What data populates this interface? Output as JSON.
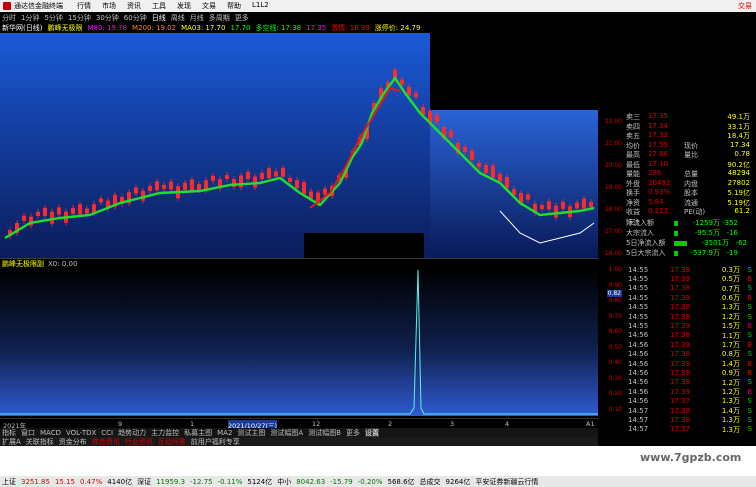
{
  "titlebar": {
    "app_name": "通达信金融终端",
    "menu": [
      "行情",
      "市场",
      "资讯",
      "工具",
      "发现",
      "文易",
      "帮助",
      "L1L2"
    ],
    "right": "交易"
  },
  "toolbar": {
    "items": [
      "分时",
      "1分钟",
      "5分钟",
      "15分钟",
      "30分钟",
      "60分钟",
      "日线",
      "周线",
      "月线",
      "多周期",
      "更多"
    ],
    "active_index": 6
  },
  "stockbar": {
    "name": "新华网(日线)",
    "indicator": "鹏峰无极限",
    "ma5": "M80: 19.78",
    "ma10": "M200: 19.02",
    "ma3": "MA03: 17.70",
    "v1": "17.70",
    "label2": "多空线: 17.38",
    "v2": "17.35",
    "stat1": "激情: 16.99",
    "stat2": "涨停价: 24.79"
  },
  "right_axis_main": [
    "22.00",
    "21.00",
    "20.00",
    "19.00",
    "18.00",
    "17.00",
    "16.00"
  ],
  "info_panel": {
    "rows": [
      {
        "c1": "卖三",
        "c2": "17.35",
        "c3": "",
        "c4": "49.1万"
      },
      {
        "c1": "卖四",
        "c2": "17.34",
        "c3": "",
        "c4": "33.1万"
      },
      {
        "c1": "卖五",
        "c2": "17.33",
        "c3": "",
        "c4": "18.4万"
      },
      {
        "c1": "均价",
        "c2": "17.55",
        "c3": "现价",
        "c4": "17.34"
      },
      {
        "c1": "最高",
        "c2": "17.66",
        "c3": "量比",
        "c4": "0.78"
      },
      {
        "c1": "最低",
        "c2": "17.10",
        "c3": "",
        "c4": "90.2亿"
      },
      {
        "c1": "量能",
        "c2": "286",
        "c3": "总量",
        "c4": "48294"
      },
      {
        "c1": "外盘",
        "c2": "20492",
        "c3": "内盘",
        "c4": "27802"
      },
      {
        "c1": "换手",
        "c2": "0.93%",
        "c3": "股本",
        "c4": "5.19亿"
      },
      {
        "c1": "净资",
        "c2": "5.84",
        "c3": "流通",
        "c4": "5.19亿"
      },
      {
        "c1": "收益(三)",
        "c2": "0.213",
        "c3": "PE(动)",
        "c4": "61.2"
      }
    ],
    "flows": [
      {
        "label": "净流入额",
        "value": "-1259万",
        "pct": "-352",
        "bar": 0.0
      },
      {
        "label": "大宗流入",
        "value": "-95.5万",
        "pct": "-16",
        "bar": 0.0
      },
      {
        "label": "5日净流入额",
        "value": "-3501万",
        "pct": "-62",
        "bar": 0.3
      },
      {
        "label": "5日大宗流入",
        "value": "-537.9万",
        "pct": "-19",
        "bar": 0.0
      }
    ]
  },
  "divider": {
    "name": "鹏峰无极限副",
    "value": "X0: 0.00"
  },
  "axis_sub": [
    "1.00",
    "0.90",
    "0.80",
    "0.70",
    "0.60",
    "0.50",
    "0.40",
    "0.30",
    "0.20",
    "0.10"
  ],
  "sub_marker": "0.82",
  "ticks": [
    {
      "t": "14:55",
      "p": "17.38",
      "v": "0.3万",
      "s": "S"
    },
    {
      "t": "14:55",
      "p": "17.39",
      "v": "0.5万",
      "s": "B"
    },
    {
      "t": "14:55",
      "p": "17.38",
      "v": "0.7万",
      "s": "S"
    },
    {
      "t": "14:55",
      "p": "17.39",
      "v": "0.6万",
      "s": "B"
    },
    {
      "t": "14:55",
      "p": "17.38",
      "v": "1.3万",
      "s": "S"
    },
    {
      "t": "14:55",
      "p": "17.38",
      "v": "1.2万",
      "s": "S"
    },
    {
      "t": "14:55",
      "p": "17.39",
      "v": "1.5万",
      "s": "B"
    },
    {
      "t": "14:56",
      "p": "17.38",
      "v": "1.1万",
      "s": "S"
    },
    {
      "t": "14:56",
      "p": "17.39",
      "v": "1.7万",
      "s": "B"
    },
    {
      "t": "14:56",
      "p": "17.38",
      "v": "0.8万",
      "s": "S"
    },
    {
      "t": "14:56",
      "p": "17.39",
      "v": "1.4万",
      "s": "B"
    },
    {
      "t": "14:56",
      "p": "17.39",
      "v": "0.9万",
      "s": "B"
    },
    {
      "t": "14:56",
      "p": "17.38",
      "v": "1.2万",
      "s": "S"
    },
    {
      "t": "14:56",
      "p": "17.39",
      "v": "1.2万",
      "s": "B"
    },
    {
      "t": "14:56",
      "p": "17.37",
      "v": "1.3万",
      "s": "S"
    },
    {
      "t": "14:57",
      "p": "17.38",
      "v": "1.4万",
      "s": "S"
    },
    {
      "t": "14:57",
      "p": "17.38",
      "v": "1.3万",
      "s": "S"
    },
    {
      "t": "14:57",
      "p": "17.37",
      "v": "1.3万",
      "s": "S"
    }
  ],
  "datebar": {
    "labels": [
      "2021年",
      "9",
      "1",
      "2021/10/27(三)",
      "12",
      "2",
      "3",
      "4"
    ],
    "right": "A1"
  },
  "tabs": [
    "指标",
    "窗口",
    "MACD",
    "VOL-TDX",
    "CCI",
    "趋势动力",
    "主力监控",
    "私募主图",
    "MA2",
    "测试主图",
    "测试幅图A",
    "测试幅图B",
    "更多",
    "设置"
  ],
  "tabs_active": 13,
  "bottombar": [
    "扩展A",
    "关联指标",
    "资金分布",
    "综合资讯",
    "行业资讯",
    "互动问答",
    "前用户福利专享"
  ],
  "bottombar_hl": [
    3,
    4,
    5
  ],
  "watermark": "www.7gpzb.com",
  "statusbar": [
    {
      "text": "上证",
      "cls": ""
    },
    {
      "text": "3251.85",
      "cls": "r"
    },
    {
      "text": "15.15",
      "cls": "r"
    },
    {
      "text": "0.47%",
      "cls": "r"
    },
    {
      "text": "4140亿",
      "cls": ""
    },
    {
      "text": "深证",
      "cls": ""
    },
    {
      "text": "11959.3",
      "cls": "g"
    },
    {
      "text": "-12.75",
      "cls": "g"
    },
    {
      "text": "-0.11%",
      "cls": "g"
    },
    {
      "text": "5124亿",
      "cls": ""
    },
    {
      "text": "中小",
      "cls": ""
    },
    {
      "text": "8042.63",
      "cls": "g"
    },
    {
      "text": "-15.79",
      "cls": "g"
    },
    {
      "text": "-0.20%",
      "cls": "g"
    },
    {
      "text": "568.6亿",
      "cls": ""
    },
    {
      "text": "总成交",
      "cls": ""
    },
    {
      "text": "9264亿",
      "cls": ""
    },
    {
      "text": "平安证券新疆云行情",
      "cls": ""
    }
  ]
}
